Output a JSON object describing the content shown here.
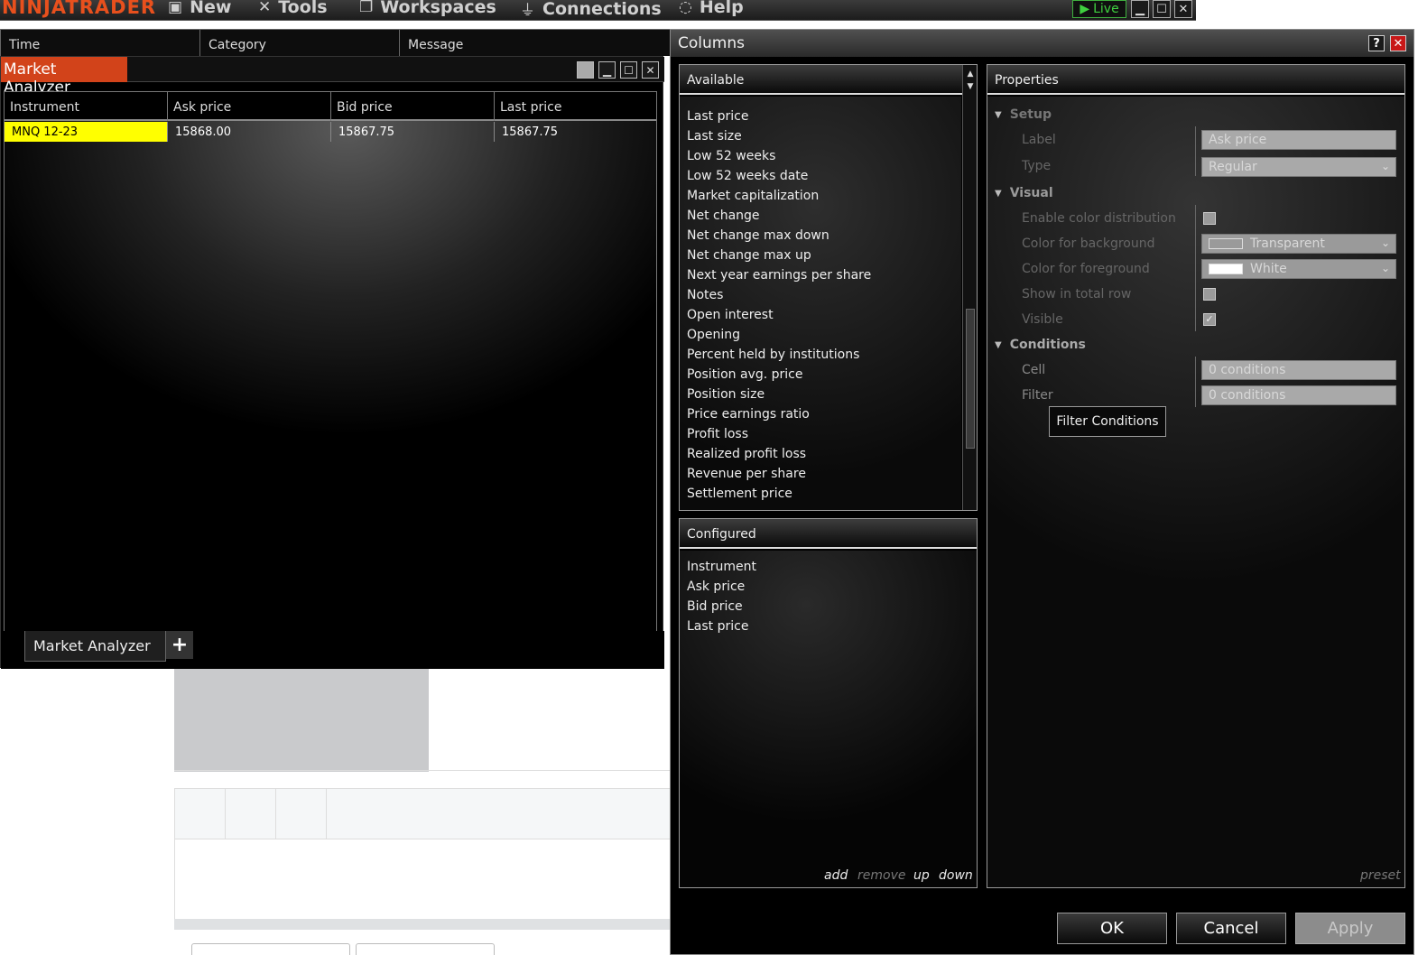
{
  "app": {
    "brand": "NINJATRADER",
    "menu": [
      {
        "label": "New",
        "icon": "new-icon"
      },
      {
        "label": "Tools",
        "icon": "tools-icon"
      },
      {
        "label": "Workspaces",
        "icon": "workspaces-icon"
      },
      {
        "label": "Connections",
        "icon": "connections-icon"
      },
      {
        "label": "Help",
        "icon": "help-icon"
      }
    ],
    "live_label": "Live"
  },
  "log": {
    "columns": [
      "Time",
      "Category",
      "Message"
    ]
  },
  "market_analyzer": {
    "title": "Market Analyzer",
    "columns": [
      "Instrument",
      "Ask price",
      "Bid price",
      "Last price"
    ],
    "rows": [
      {
        "instrument": "MNQ 12-23",
        "ask": "15868.00",
        "bid": "15867.75",
        "last": "15867.75"
      }
    ],
    "tab_label": "Market Analyzer",
    "add_tab": "+",
    "instrument_highlight": "#ffff00"
  },
  "columns_dialog": {
    "title": "Columns",
    "help": "?",
    "available": {
      "header": "Available",
      "items": [
        "Last price",
        "Last size",
        "Low 52 weeks",
        "Low 52 weeks date",
        "Market capitalization",
        "Net change",
        "Net change max down",
        "Net change max up",
        "Next year earnings per share",
        "Notes",
        "Open interest",
        "Opening",
        "Percent held by institutions",
        "Position avg. price",
        "Position size",
        "Price earnings ratio",
        "Profit loss",
        "Realized profit loss",
        "Revenue per share",
        "Settlement price"
      ]
    },
    "configured": {
      "header": "Configured",
      "items": [
        "Instrument",
        "Ask price",
        "Bid price",
        "Last price"
      ],
      "actions": {
        "add": "add",
        "remove": "remove",
        "up": "up",
        "down": "down"
      }
    },
    "properties": {
      "header": "Properties",
      "sections": {
        "setup": "Setup",
        "visual": "Visual",
        "conditions": "Conditions"
      },
      "setup": {
        "label_label": "Label",
        "label_value": "Ask price",
        "type_label": "Type",
        "type_value": "Regular"
      },
      "visual": {
        "enable_color_distribution": "Enable color distribution",
        "color_background_label": "Color for background",
        "color_background_value": "Transparent",
        "color_foreground_label": "Color for foreground",
        "color_foreground_value": "White",
        "show_in_total_row": "Show in total row",
        "visible": "Visible",
        "visible_checked": true
      },
      "conditions": {
        "cell_label": "Cell",
        "cell_value": "0 conditions",
        "filter_label": "Filter",
        "filter_value": "0 conditions",
        "filter_button": "Filter Conditions"
      },
      "preset": "preset"
    },
    "buttons": {
      "ok": "OK",
      "cancel": "Cancel",
      "apply": "Apply"
    }
  },
  "colors": {
    "brand": "#e8501d",
    "ma_title": "#d2431a",
    "live": "#3fd03f",
    "close": "#c81818"
  }
}
